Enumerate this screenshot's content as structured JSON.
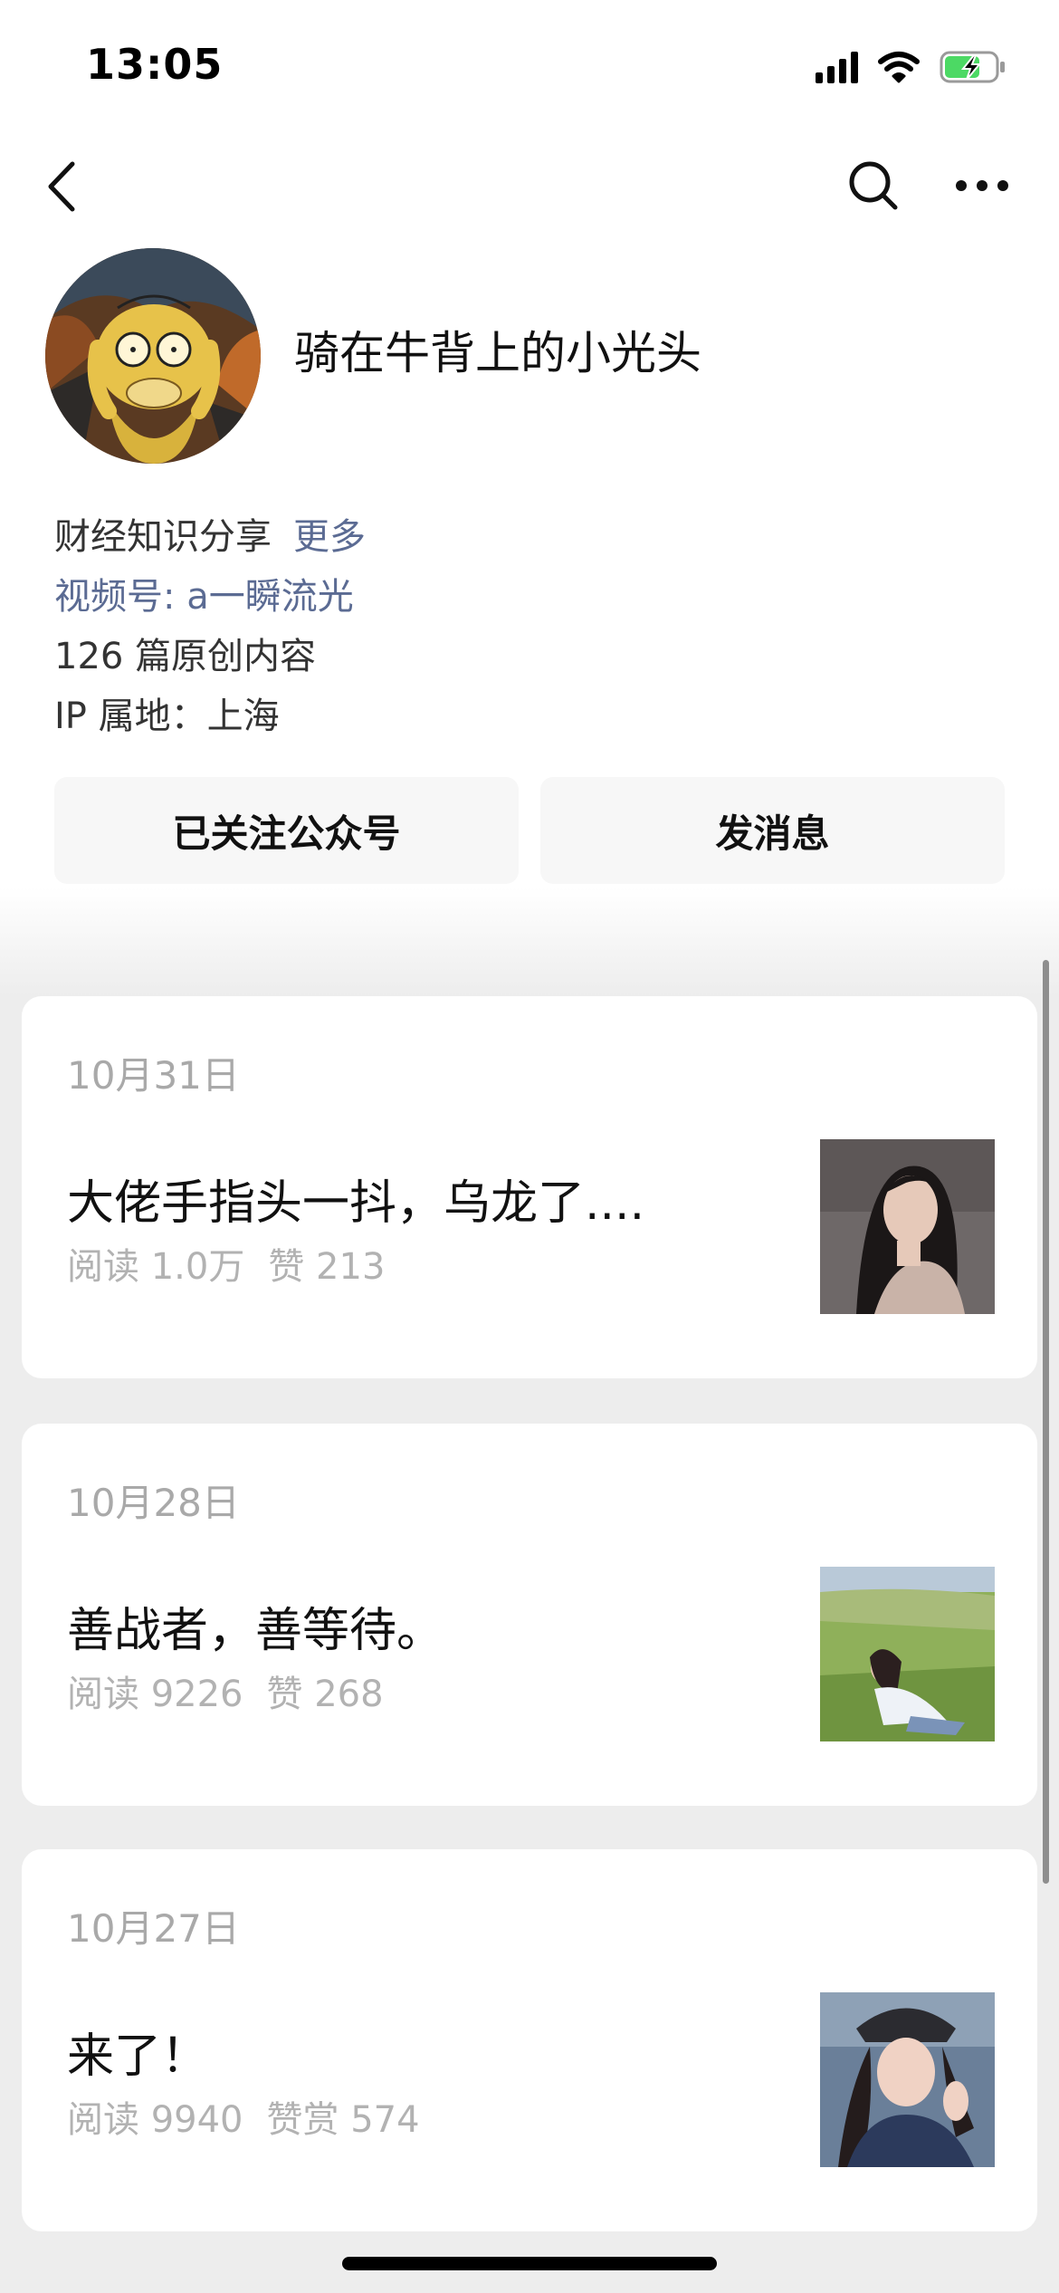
{
  "status_bar": {
    "time": "13:05"
  },
  "profile": {
    "name": "骑在牛背上的小光头",
    "description": "财经知识分享",
    "more_link": "更多",
    "video_account": "视频号: a一瞬流光",
    "original_count": "126 篇原创内容",
    "ip_location": "IP 属地：上海"
  },
  "actions": {
    "followed_label": "已关注公众号",
    "message_label": "发消息"
  },
  "articles": [
    {
      "date": "10月31日",
      "title": "大佬手指头一抖，乌龙了....",
      "reads": "阅读 1.0万",
      "likes": "赞 213"
    },
    {
      "date": "10月28日",
      "title": "善战者，善等待。",
      "reads": "阅读 9226",
      "likes": "赞 268"
    },
    {
      "date": "10月27日",
      "title": "来了！",
      "reads": "阅读 9940",
      "likes": "赞赏 574"
    }
  ],
  "icons": {
    "back": "chevron-left-icon",
    "search": "search-icon",
    "more": "more-dots-icon",
    "signal": "signal-icon",
    "wifi": "wifi-icon",
    "battery": "battery-charging-icon"
  },
  "colors": {
    "link": "#5b6b93",
    "meta_gray": "#b2b2b2",
    "background": "#ededed",
    "battery_green": "#4cd964"
  }
}
